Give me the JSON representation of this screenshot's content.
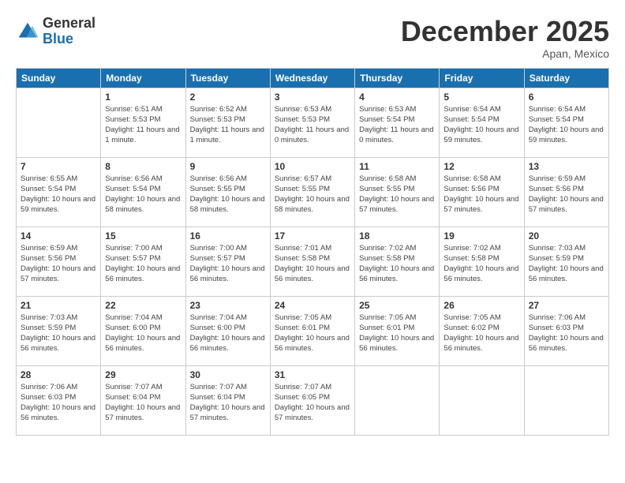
{
  "header": {
    "logo_general": "General",
    "logo_blue": "Blue",
    "month_title": "December 2025",
    "subtitle": "Apan, Mexico"
  },
  "days_of_week": [
    "Sunday",
    "Monday",
    "Tuesday",
    "Wednesday",
    "Thursday",
    "Friday",
    "Saturday"
  ],
  "weeks": [
    [
      {
        "date": "",
        "sunrise": "",
        "sunset": "",
        "daylight": ""
      },
      {
        "date": "1",
        "sunrise": "Sunrise: 6:51 AM",
        "sunset": "Sunset: 5:53 PM",
        "daylight": "Daylight: 11 hours and 1 minute."
      },
      {
        "date": "2",
        "sunrise": "Sunrise: 6:52 AM",
        "sunset": "Sunset: 5:53 PM",
        "daylight": "Daylight: 11 hours and 1 minute."
      },
      {
        "date": "3",
        "sunrise": "Sunrise: 6:53 AM",
        "sunset": "Sunset: 5:53 PM",
        "daylight": "Daylight: 11 hours and 0 minutes."
      },
      {
        "date": "4",
        "sunrise": "Sunrise: 6:53 AM",
        "sunset": "Sunset: 5:54 PM",
        "daylight": "Daylight: 11 hours and 0 minutes."
      },
      {
        "date": "5",
        "sunrise": "Sunrise: 6:54 AM",
        "sunset": "Sunset: 5:54 PM",
        "daylight": "Daylight: 10 hours and 59 minutes."
      },
      {
        "date": "6",
        "sunrise": "Sunrise: 6:54 AM",
        "sunset": "Sunset: 5:54 PM",
        "daylight": "Daylight: 10 hours and 59 minutes."
      }
    ],
    [
      {
        "date": "7",
        "sunrise": "Sunrise: 6:55 AM",
        "sunset": "Sunset: 5:54 PM",
        "daylight": "Daylight: 10 hours and 59 minutes."
      },
      {
        "date": "8",
        "sunrise": "Sunrise: 6:56 AM",
        "sunset": "Sunset: 5:54 PM",
        "daylight": "Daylight: 10 hours and 58 minutes."
      },
      {
        "date": "9",
        "sunrise": "Sunrise: 6:56 AM",
        "sunset": "Sunset: 5:55 PM",
        "daylight": "Daylight: 10 hours and 58 minutes."
      },
      {
        "date": "10",
        "sunrise": "Sunrise: 6:57 AM",
        "sunset": "Sunset: 5:55 PM",
        "daylight": "Daylight: 10 hours and 58 minutes."
      },
      {
        "date": "11",
        "sunrise": "Sunrise: 6:58 AM",
        "sunset": "Sunset: 5:55 PM",
        "daylight": "Daylight: 10 hours and 57 minutes."
      },
      {
        "date": "12",
        "sunrise": "Sunrise: 6:58 AM",
        "sunset": "Sunset: 5:56 PM",
        "daylight": "Daylight: 10 hours and 57 minutes."
      },
      {
        "date": "13",
        "sunrise": "Sunrise: 6:59 AM",
        "sunset": "Sunset: 5:56 PM",
        "daylight": "Daylight: 10 hours and 57 minutes."
      }
    ],
    [
      {
        "date": "14",
        "sunrise": "Sunrise: 6:59 AM",
        "sunset": "Sunset: 5:56 PM",
        "daylight": "Daylight: 10 hours and 57 minutes."
      },
      {
        "date": "15",
        "sunrise": "Sunrise: 7:00 AM",
        "sunset": "Sunset: 5:57 PM",
        "daylight": "Daylight: 10 hours and 56 minutes."
      },
      {
        "date": "16",
        "sunrise": "Sunrise: 7:00 AM",
        "sunset": "Sunset: 5:57 PM",
        "daylight": "Daylight: 10 hours and 56 minutes."
      },
      {
        "date": "17",
        "sunrise": "Sunrise: 7:01 AM",
        "sunset": "Sunset: 5:58 PM",
        "daylight": "Daylight: 10 hours and 56 minutes."
      },
      {
        "date": "18",
        "sunrise": "Sunrise: 7:02 AM",
        "sunset": "Sunset: 5:58 PM",
        "daylight": "Daylight: 10 hours and 56 minutes."
      },
      {
        "date": "19",
        "sunrise": "Sunrise: 7:02 AM",
        "sunset": "Sunset: 5:58 PM",
        "daylight": "Daylight: 10 hours and 56 minutes."
      },
      {
        "date": "20",
        "sunrise": "Sunrise: 7:03 AM",
        "sunset": "Sunset: 5:59 PM",
        "daylight": "Daylight: 10 hours and 56 minutes."
      }
    ],
    [
      {
        "date": "21",
        "sunrise": "Sunrise: 7:03 AM",
        "sunset": "Sunset: 5:59 PM",
        "daylight": "Daylight: 10 hours and 56 minutes."
      },
      {
        "date": "22",
        "sunrise": "Sunrise: 7:04 AM",
        "sunset": "Sunset: 6:00 PM",
        "daylight": "Daylight: 10 hours and 56 minutes."
      },
      {
        "date": "23",
        "sunrise": "Sunrise: 7:04 AM",
        "sunset": "Sunset: 6:00 PM",
        "daylight": "Daylight: 10 hours and 56 minutes."
      },
      {
        "date": "24",
        "sunrise": "Sunrise: 7:05 AM",
        "sunset": "Sunset: 6:01 PM",
        "daylight": "Daylight: 10 hours and 56 minutes."
      },
      {
        "date": "25",
        "sunrise": "Sunrise: 7:05 AM",
        "sunset": "Sunset: 6:01 PM",
        "daylight": "Daylight: 10 hours and 56 minutes."
      },
      {
        "date": "26",
        "sunrise": "Sunrise: 7:05 AM",
        "sunset": "Sunset: 6:02 PM",
        "daylight": "Daylight: 10 hours and 56 minutes."
      },
      {
        "date": "27",
        "sunrise": "Sunrise: 7:06 AM",
        "sunset": "Sunset: 6:03 PM",
        "daylight": "Daylight: 10 hours and 56 minutes."
      }
    ],
    [
      {
        "date": "28",
        "sunrise": "Sunrise: 7:06 AM",
        "sunset": "Sunset: 6:03 PM",
        "daylight": "Daylight: 10 hours and 56 minutes."
      },
      {
        "date": "29",
        "sunrise": "Sunrise: 7:07 AM",
        "sunset": "Sunset: 6:04 PM",
        "daylight": "Daylight: 10 hours and 57 minutes."
      },
      {
        "date": "30",
        "sunrise": "Sunrise: 7:07 AM",
        "sunset": "Sunset: 6:04 PM",
        "daylight": "Daylight: 10 hours and 57 minutes."
      },
      {
        "date": "31",
        "sunrise": "Sunrise: 7:07 AM",
        "sunset": "Sunset: 6:05 PM",
        "daylight": "Daylight: 10 hours and 57 minutes."
      },
      {
        "date": "",
        "sunrise": "",
        "sunset": "",
        "daylight": ""
      },
      {
        "date": "",
        "sunrise": "",
        "sunset": "",
        "daylight": ""
      },
      {
        "date": "",
        "sunrise": "",
        "sunset": "",
        "daylight": ""
      }
    ]
  ]
}
